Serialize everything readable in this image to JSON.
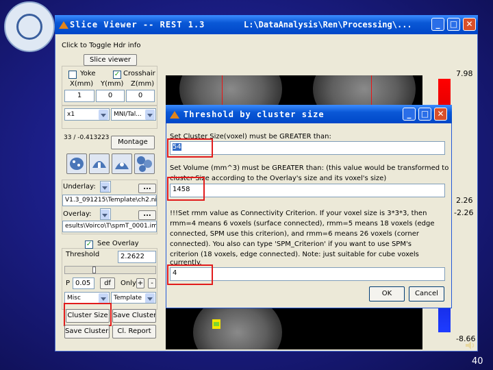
{
  "window": {
    "title": "Slice Viewer -- REST 1.3",
    "path": "L:\\DataAnalysis\\Ren\\Processing\\...",
    "minimize_glyph": "_",
    "maximize_glyph": "□",
    "close_glyph": "✕"
  },
  "panel": {
    "toggle_hdr": "Click to Toggle Hdr info",
    "slice_viewer_btn": "Slice viewer",
    "yoke_label": "Yoke",
    "crosshair_label": "Crosshair",
    "coord_labels": [
      "X(mm)",
      "Y(mm)",
      "Z(mm)"
    ],
    "coords": [
      "1",
      "0",
      "0"
    ],
    "zoom_value": "x1",
    "template_value": "MNI/Tal...",
    "voxel_text": "33 / -0.413223",
    "montage_btn": "Montage",
    "underlay_label": "Underlay:",
    "underlay_path": "V1.3_091215\\Template\\ch2.nii",
    "overlay_label": "Overlay:",
    "overlay_path": "esults\\Voirco\\T\\spmT_0001.img",
    "browse_btn": "...",
    "see_overlay": "See Overlay",
    "threshold_label": "Threshold",
    "threshold_value": "2.2622",
    "p_label": "P",
    "p_value": "0.05",
    "df_btn": "df",
    "only_label": "Only",
    "plus_btn": "+",
    "minus_btn": "-",
    "misc_value": "Misc",
    "template_btn": "Template",
    "cluster_size_btn": "Cluster Size",
    "save_cluster_btn": "Save Cluster",
    "save_clusters_btn": "Save Clusters",
    "cl_report_btn": "Cl. Report"
  },
  "colorbar": {
    "max": "7.98",
    "pos_thresh": "2.26",
    "neg_thresh": "-2.26",
    "min": "-8.66",
    "colors": [
      "#ff0000",
      "#9e0000",
      "#000000",
      "#0000a0",
      "#1e3cff"
    ]
  },
  "dialog": {
    "title": "Threshold by cluster size",
    "q1": "Set Cluster Size(voxel) must be GREATER than:",
    "a1": "54",
    "q2_line1": "Set Volume (mm^3) must be GREATER than: (this value would be transformed to",
    "q2_line2": "cluster Size according to the Overlay's size and its voxel's size)",
    "a2": "1458",
    "q3_lines": [
      "!!!Set rmm value as Connectivity Criterion. If your voxel size is 3*3*3, then",
      "rmm=4 means 6 voxels (surface connected), rmm=5 means 18 voxels (edge",
      "connected, SPM use this criterion), and rmm=6 means 26 voxels (corner",
      "connected). You also can type 'SPM_Criterion' if you want to use SPM's",
      "criterion (18 voxels, edge connected). Note: just suitable for cube voxels",
      "currently."
    ],
    "a3": "4",
    "ok_btn": "OK",
    "cancel_btn": "Cancel"
  },
  "highlight_color": "#e11b1b",
  "page_number": "40"
}
